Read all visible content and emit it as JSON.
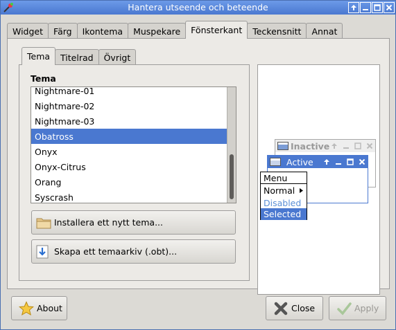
{
  "window": {
    "title": "Hantera utseende och beteende"
  },
  "colors": {
    "accent": "#4a78d0",
    "titlebar": "#5a86dc",
    "disabled": "#5b8fd6"
  },
  "tabs": [
    "Widget",
    "Färg",
    "Ikontema",
    "Muspekare",
    "Fönsterkant",
    "Teckensnitt",
    "Annat"
  ],
  "active_tab": "Fönsterkant",
  "subtabs": [
    "Tema",
    "Titelrad",
    "Övrigt"
  ],
  "active_subtab": "Tema",
  "theme_section": {
    "title": "Tema",
    "items": [
      "Nightmare-01",
      "Nightmare-02",
      "Nightmare-03",
      "Obatross",
      "Onyx",
      "Onyx-Citrus",
      "Orang",
      "Syscrash"
    ],
    "selected": "Obatross"
  },
  "buttons": {
    "install": "Installera ett nytt tema...",
    "create_archive": "Skapa ett temaarkiv (.obt)...",
    "about": "About",
    "close": "Close",
    "apply": "Apply"
  },
  "preview": {
    "inactive_title": "Inactive",
    "active_title": "Active",
    "menu": {
      "title": "Menu",
      "normal": "Normal",
      "disabled": "Disabled",
      "selected": "Selected"
    }
  },
  "icons": {
    "app": "app-icon",
    "titlebar": [
      "shade-icon",
      "minimize-icon",
      "maximize-icon",
      "close-icon"
    ],
    "install": "folder-icon",
    "archive": "download-arrow-icon",
    "about": "star-icon",
    "close": "x-icon",
    "apply": "checkmark-icon"
  }
}
